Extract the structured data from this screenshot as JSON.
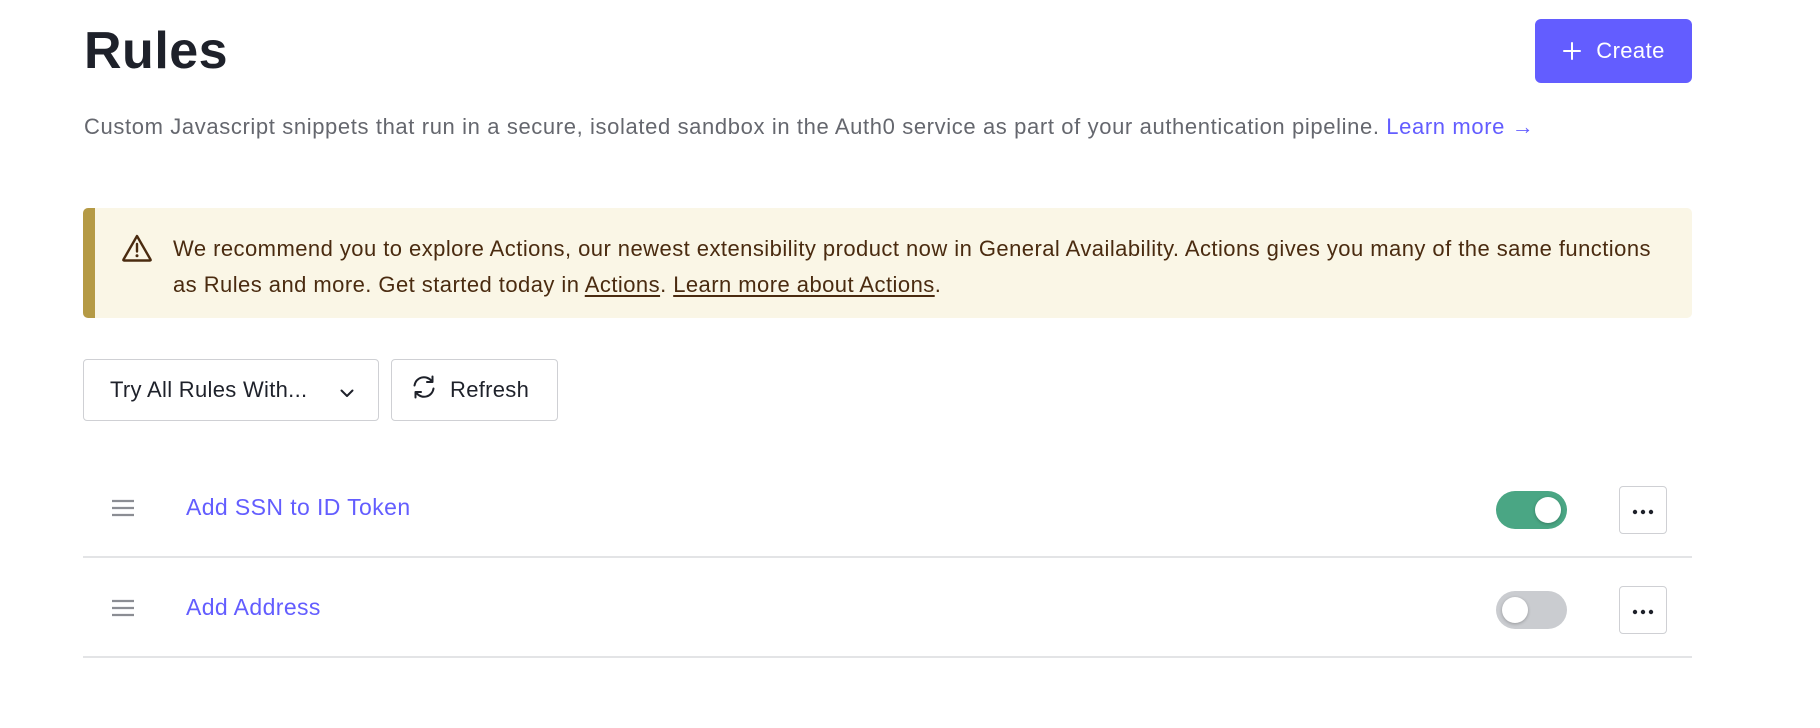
{
  "header": {
    "title": "Rules",
    "create_label": "Create",
    "create_icon": "plus-icon",
    "description": "Custom Javascript snippets that run in a secure, isolated sandbox in the Auth0 service as part of your authentication pipeline.",
    "learn_more_label": "Learn more →"
  },
  "alert": {
    "icon": "warning-triangle-icon",
    "text_before": "We recommend you to explore Actions, our newest extensibility product now in General Availability. Actions gives you many of the same functions as Rules and more. Get started today in ",
    "actions_link": "Actions",
    "separator": ". ",
    "learn_more_link": "Learn more about Actions",
    "text_after": "."
  },
  "toolbar": {
    "try_rules_label": "Try All Rules With...",
    "refresh_label": "Refresh"
  },
  "rules": [
    {
      "name": "Add SSN to ID Token",
      "enabled": true
    },
    {
      "name": "Add Address",
      "enabled": false
    }
  ],
  "colors": {
    "accent": "#635dff",
    "toggle_on": "#4aa684",
    "toggle_off": "#caccd0",
    "alert_bar": "#b59a45",
    "alert_bg": "#faf6e6"
  }
}
